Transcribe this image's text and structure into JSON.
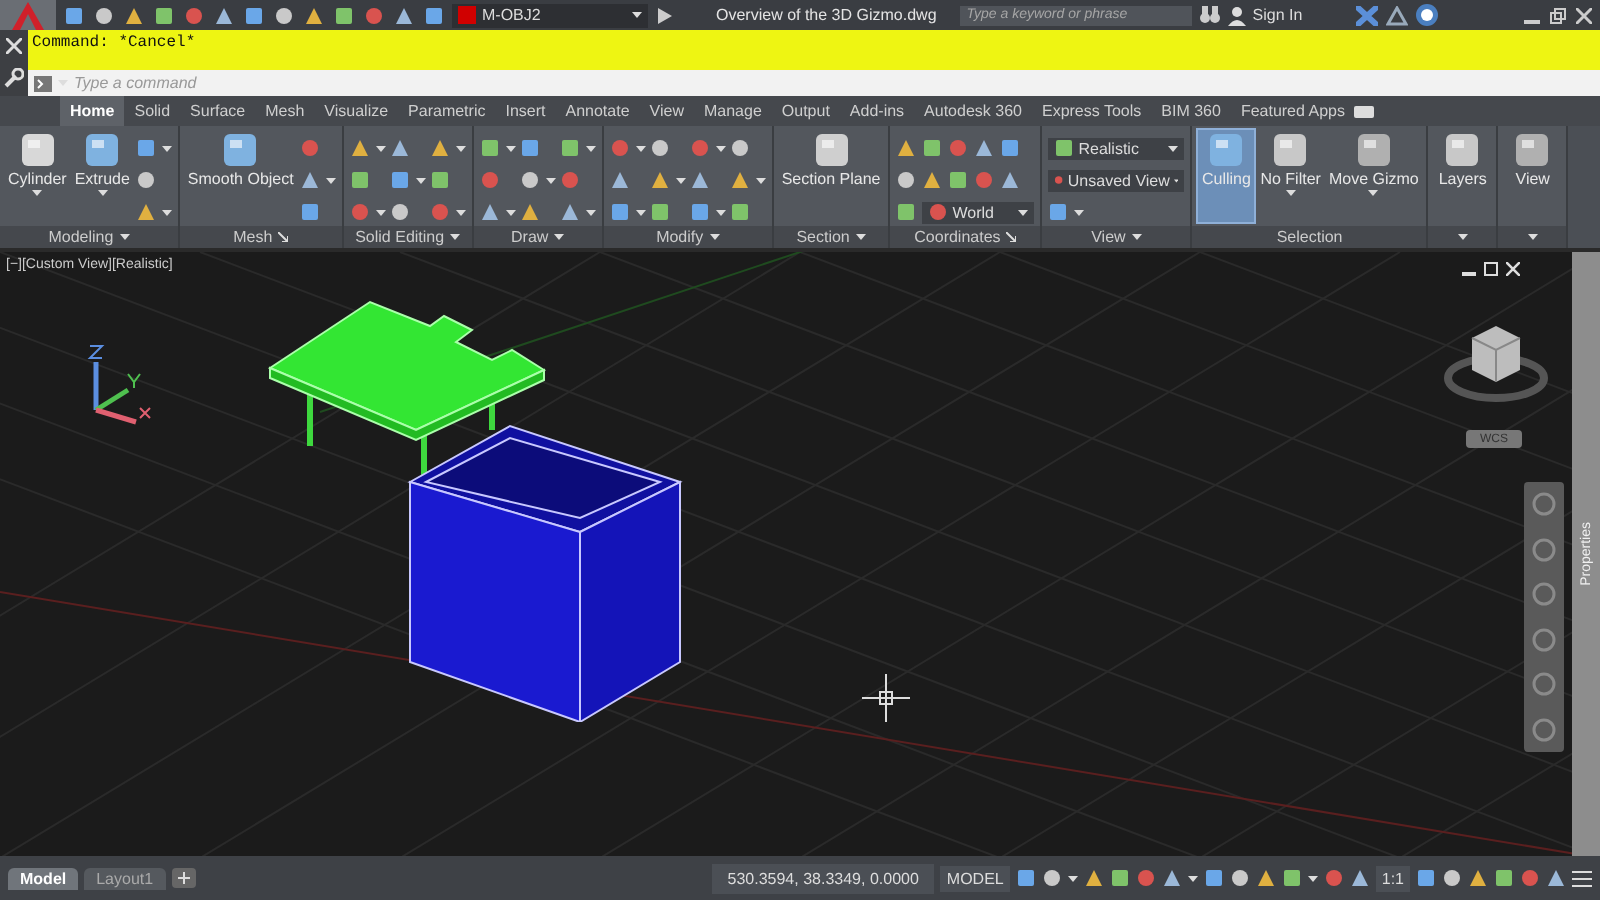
{
  "title_bar": {
    "layer": "M-OBJ2",
    "title": "Overview of the 3D Gizmo.dwg",
    "search": {
      "placeholder": "Type a keyword or phrase"
    },
    "sign_in": "Sign In"
  },
  "command_history": "Command: *Cancel*",
  "command_line": {
    "placeholder": "Type a command"
  },
  "ribbon_tabs": [
    {
      "label": "Home",
      "selected": true
    },
    {
      "label": "Solid",
      "selected": false
    },
    {
      "label": "Surface",
      "selected": false
    },
    {
      "label": "Mesh",
      "selected": false
    },
    {
      "label": "Visualize",
      "selected": false
    },
    {
      "label": "Parametric",
      "selected": false
    },
    {
      "label": "Insert",
      "selected": false
    },
    {
      "label": "Annotate",
      "selected": false
    },
    {
      "label": "View",
      "selected": false
    },
    {
      "label": "Manage",
      "selected": false
    },
    {
      "label": "Output",
      "selected": false
    },
    {
      "label": "Add-ins",
      "selected": false
    },
    {
      "label": "Autodesk 360",
      "selected": false
    },
    {
      "label": "Express Tools",
      "selected": false
    },
    {
      "label": "BIM 360",
      "selected": false
    },
    {
      "label": "Featured Apps",
      "selected": false
    }
  ],
  "ribbon_panels": [
    {
      "title": "Modeling",
      "dropdown_menu": true,
      "dialog_launcher": false,
      "tools": [
        {
          "kind": "large",
          "label": "Cylinder",
          "dropdown": true
        },
        {
          "kind": "large",
          "label": "Extrude",
          "dropdown": true
        },
        {
          "kind": "icon_column"
        }
      ]
    },
    {
      "title": "Mesh",
      "dropdown_menu": false,
      "dialog_launcher": true,
      "tools": [
        {
          "kind": "large",
          "label": "Smooth Object",
          "dropdown": false
        },
        {
          "kind": "icon_column"
        }
      ]
    },
    {
      "title": "Solid Editing",
      "dropdown_menu": true,
      "dialog_launcher": false,
      "tools": [
        {
          "kind": "icon_column"
        },
        {
          "kind": "icon_column"
        },
        {
          "kind": "icon_column"
        }
      ]
    },
    {
      "title": "Draw",
      "dropdown_menu": true,
      "dialog_launcher": false,
      "tools": [
        {
          "kind": "icon_column"
        },
        {
          "kind": "icon_column"
        },
        {
          "kind": "icon_column"
        }
      ]
    },
    {
      "title": "Modify",
      "dropdown_menu": true,
      "dialog_launcher": false,
      "tools": [
        {
          "kind": "icon_column"
        },
        {
          "kind": "icon_column"
        },
        {
          "kind": "icon_column"
        },
        {
          "kind": "icon_column"
        }
      ]
    },
    {
      "title": "Section",
      "dropdown_menu": true,
      "dialog_launcher": false,
      "tools": [
        {
          "kind": "large",
          "label": "Section Plane",
          "dropdown": false
        }
      ]
    },
    {
      "title": "Coordinates",
      "dropdown_menu": false,
      "dialog_launcher": true,
      "tools": [
        {
          "kind": "icons_over_dropdown",
          "value": "World"
        }
      ]
    },
    {
      "title": "View",
      "dropdown_menu": true,
      "dialog_launcher": false,
      "tools": [
        {
          "kind": "dropdown_column",
          "values": [
            "Realistic",
            "Unsaved View"
          ]
        }
      ]
    },
    {
      "title": "Selection",
      "dropdown_menu": false,
      "dialog_launcher": false,
      "tools": [
        {
          "kind": "toggle",
          "label": "Culling",
          "on": true
        },
        {
          "kind": "large",
          "label": "No Filter",
          "dropdown": true
        },
        {
          "kind": "large",
          "label": "Move Gizmo",
          "dropdown": true
        }
      ]
    },
    {
      "dropdown_menu": true,
      "dialog_launcher": false,
      "tools": [
        {
          "kind": "large",
          "label": "Layers",
          "dropdown": false
        }
      ]
    },
    {
      "dropdown_menu": true,
      "dialog_launcher": false,
      "tools": [
        {
          "kind": "large",
          "label": "View",
          "dropdown": false
        }
      ]
    }
  ],
  "viewport": {
    "label": "[−][Custom View][Realistic]",
    "view_cube": "WCS",
    "palette": "Properties"
  },
  "status_bar": {
    "layout_tabs": [
      {
        "label": "Model",
        "selected": true
      },
      {
        "label": "Layout1",
        "selected": false
      }
    ],
    "coordinates": "530.3594, 38.3349, 0.0000",
    "space": "MODEL",
    "scale": "1:1"
  }
}
